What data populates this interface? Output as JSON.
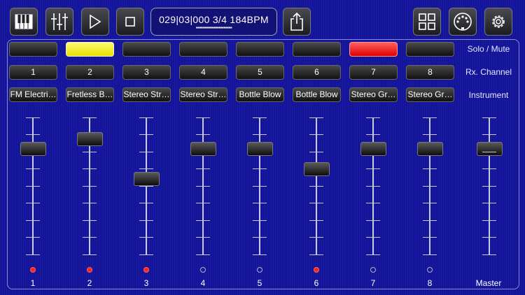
{
  "toolbar": {
    "position_display": "029|03|000 3/4 184BPM",
    "beat_indicator": "▪▪▪▪▪▪▪▪▪▪▪▪▪▪▪▪▪▪▪▪▪▪"
  },
  "rows": {
    "solo_mute_label": "Solo / Mute",
    "rx_channel_label": "Rx. Channel",
    "instrument_label": "Instrument"
  },
  "channels": [
    {
      "solo": "normal",
      "rx": "1",
      "instrument": "FM Electri…",
      "led": "on",
      "label": "1",
      "fader": 0.8
    },
    {
      "solo": "yellow",
      "rx": "2",
      "instrument": "Fretless B…",
      "led": "on",
      "label": "2",
      "fader": 0.88
    },
    {
      "solo": "normal",
      "rx": "3",
      "instrument": "Stereo Str…",
      "led": "on",
      "label": "3",
      "fader": 0.56
    },
    {
      "solo": "normal",
      "rx": "4",
      "instrument": "Stereo Str…",
      "led": "off",
      "label": "4",
      "fader": 0.8
    },
    {
      "solo": "normal",
      "rx": "5",
      "instrument": "Bottle Blow",
      "led": "off",
      "label": "5",
      "fader": 0.8
    },
    {
      "solo": "normal",
      "rx": "6",
      "instrument": "Bottle Blow",
      "led": "on",
      "label": "6",
      "fader": 0.64
    },
    {
      "solo": "red",
      "rx": "7",
      "instrument": "Stereo Gr…",
      "led": "off",
      "label": "7",
      "fader": 0.8
    },
    {
      "solo": "normal",
      "rx": "8",
      "instrument": "Stereo Gr…",
      "led": "off",
      "label": "8",
      "fader": 0.8
    }
  ],
  "master": {
    "label": "Master",
    "fader": 0.8
  },
  "colors": {
    "background": "#14149a",
    "solo_yellow": "#f2ee00",
    "mute_red": "#ff2020"
  }
}
